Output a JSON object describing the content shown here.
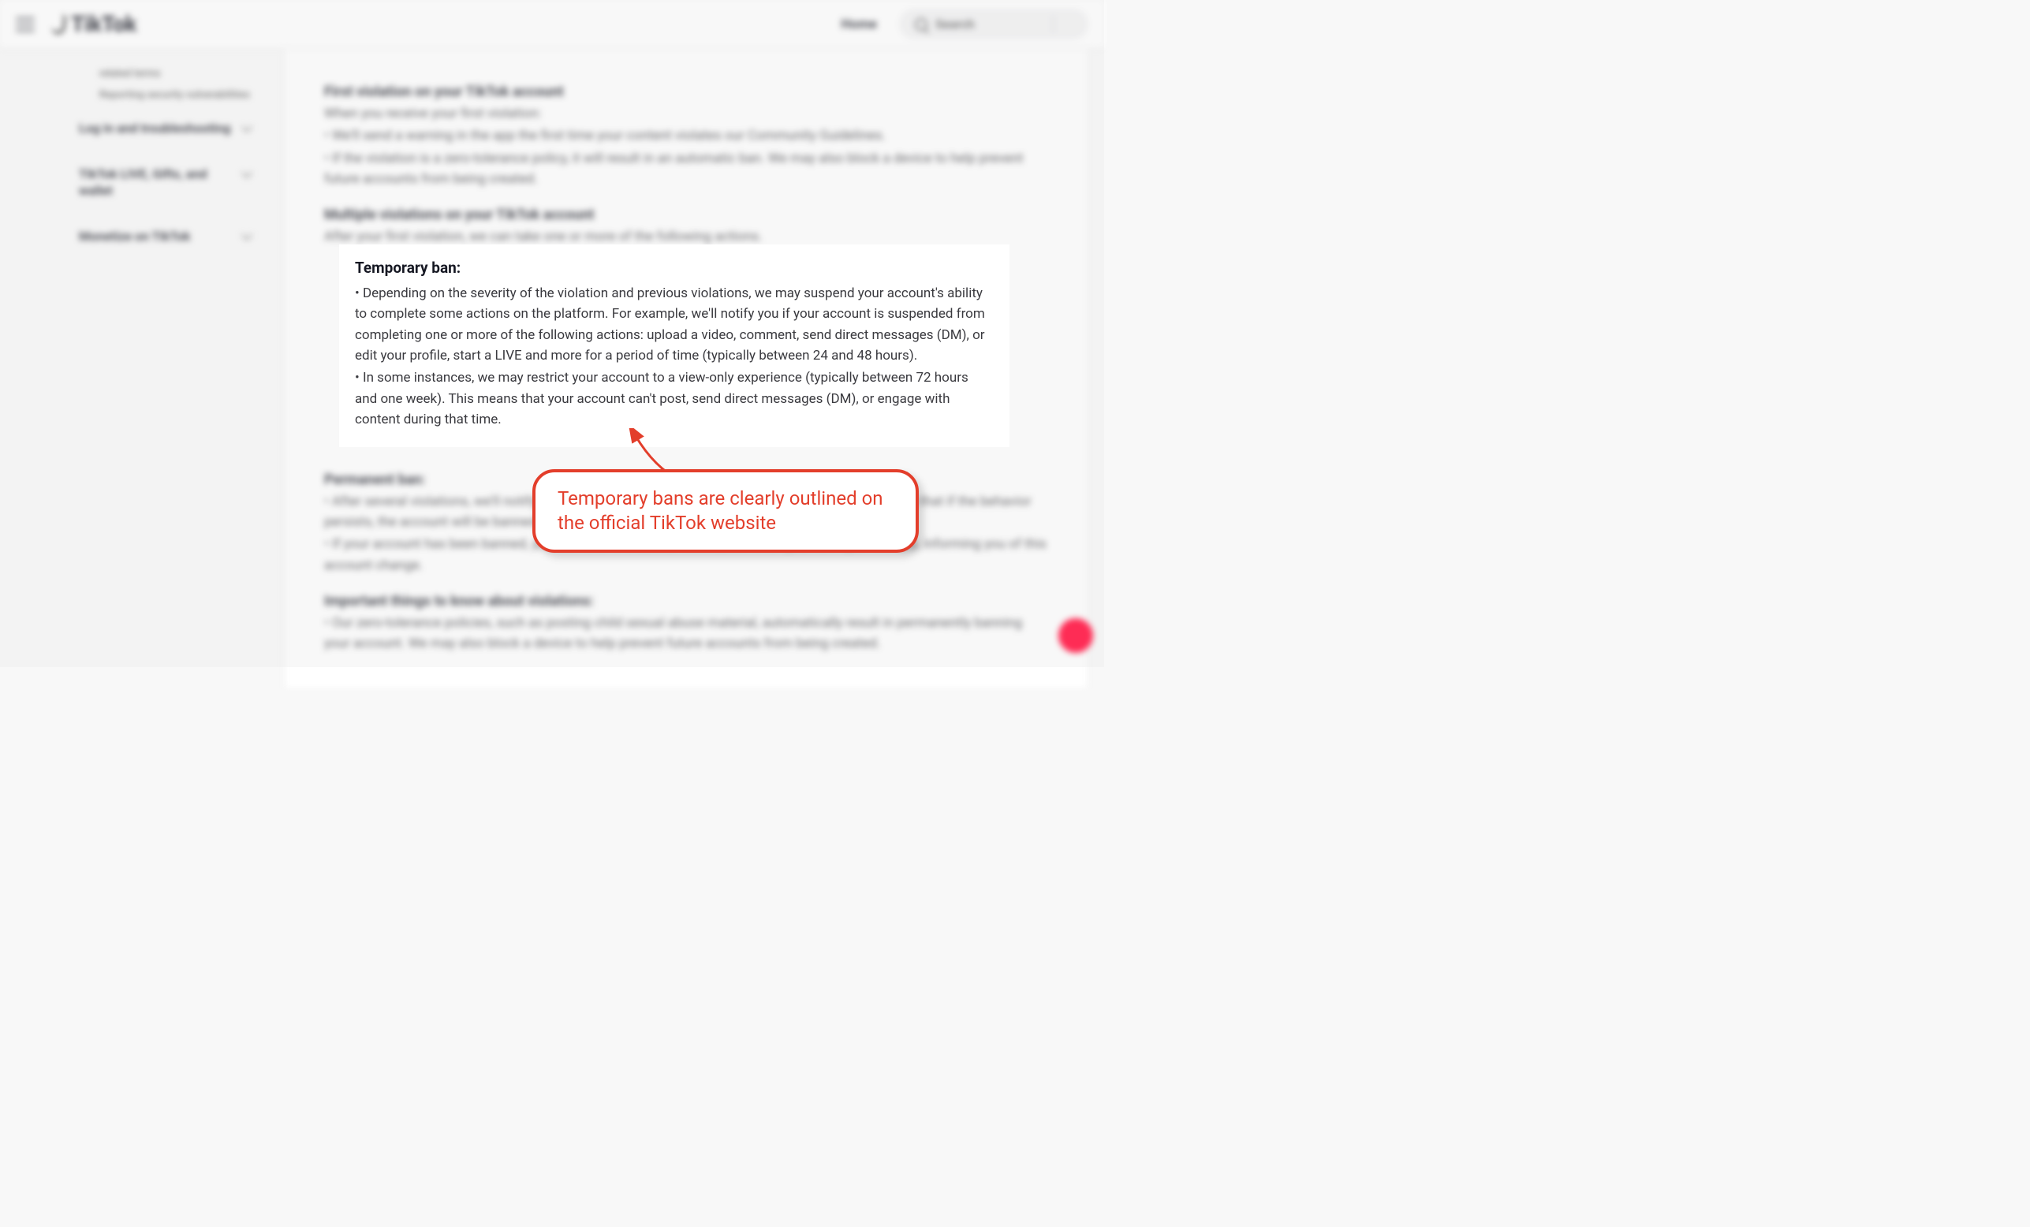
{
  "header": {
    "brand": "TikTok",
    "home": "Home",
    "search_label": "Search"
  },
  "sidebar": {
    "sub1": "related terms",
    "sub2": "Reporting security vulnerabilities",
    "item1": "Log in and troubleshooting",
    "item2": "TikTok LIVE, Gifts, and wallet",
    "item3": "Monetize on TikTok"
  },
  "article": {
    "first_h": "First violation on your TikTok account",
    "first_lead": "When you receive your first violation:",
    "first_b1": "• We'll send a warning in the app the first time your content violates our Community Guidelines.",
    "first_b2": "• If the violation is a zero-tolerance policy, it will result in an automatic ban. We may also block a device to help prevent future accounts from being created.",
    "multi_h": "Multiple violations on your TikTok account",
    "multi_lead": "After your first violation, we can take one or more of the following actions.",
    "temp_h": "Temporary ban:",
    "temp_b1": "• Depending on the severity of the violation and previous violations, we may suspend your account's ability to complete some actions on the platform. For example, we'll notify you if your account is suspended from completing one or more of the following actions: upload a video, comment, send direct messages (DM), or edit your profile, start a LIVE and more for a period of time (typically between 24 and 48 hours).",
    "temp_b2": "• In some instances, we may restrict your account to a view-only experience (typically between 72 hours and one week). This means that your account can't post, send direct messages (DM), or engage with content during that time.",
    "perm_h": "Permanent ban:",
    "perm_b1": "• After several violations, we'll notify you that your account may be permanently banned. This means that if the behavior persists, the account will be banned.",
    "perm_b2": "• If your account has been banned, you will receive a banner notification when you next open the app, informing you of this account change.",
    "imp_h": "Important things to know about violations:",
    "imp_b1": "• Our zero-tolerance policies, such as posting child sexual abuse material, automatically result in permanently banning your account. We may also block a device to help prevent future accounts from being created."
  },
  "annotation": {
    "text": "Temporary bans are clearly outlined on the official TikTok website"
  }
}
